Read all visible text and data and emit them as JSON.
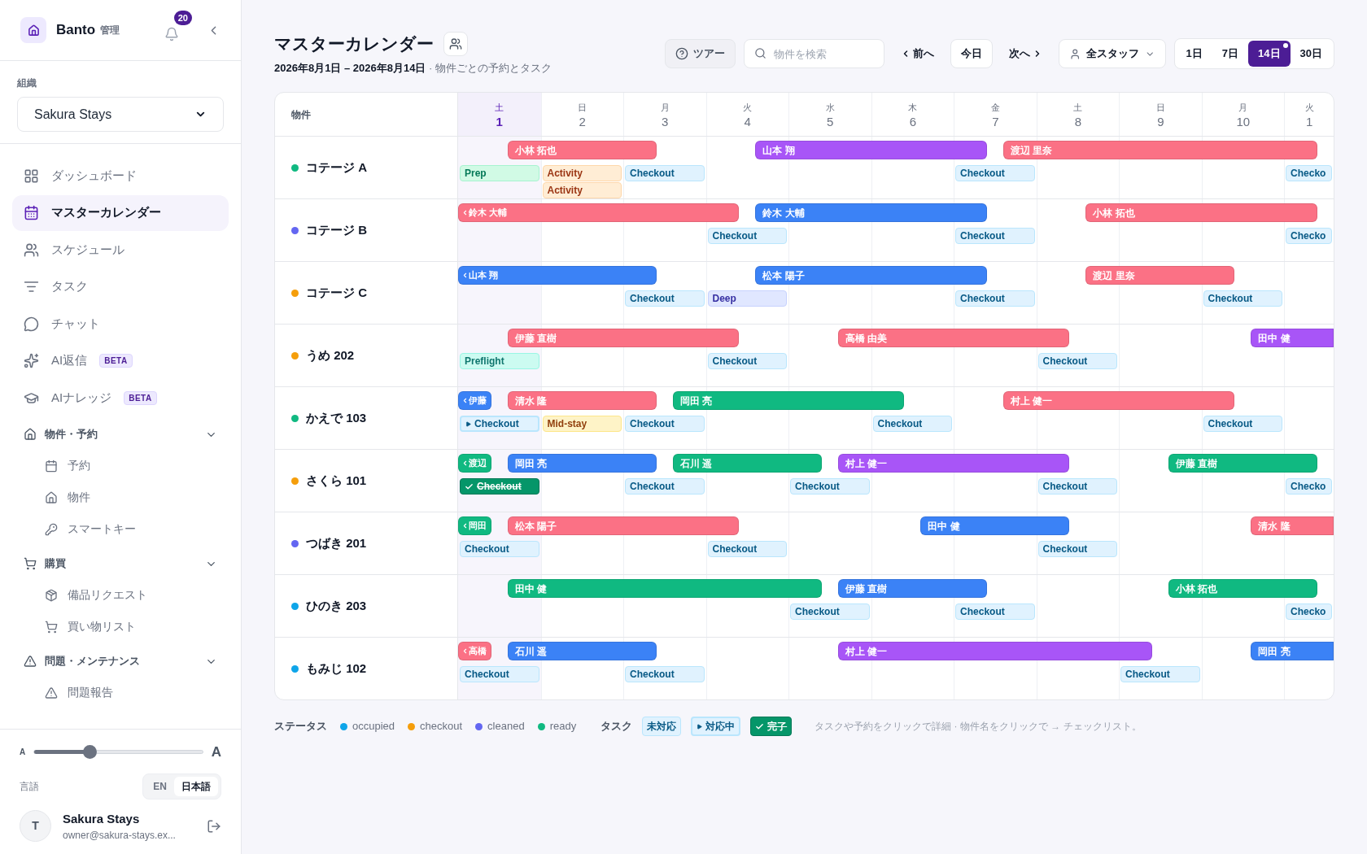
{
  "sidebar": {
    "brand": "Banto",
    "brand_tag": "管理",
    "notifications": "20",
    "org_label": "組織",
    "org_value": "Sakura Stays",
    "nav": [
      {
        "label": "ダッシュボード",
        "selected": false
      },
      {
        "label": "マスターカレンダー",
        "selected": true
      },
      {
        "label": "スケジュール",
        "selected": false
      },
      {
        "label": "タスク",
        "selected": false
      },
      {
        "label": "チャット",
        "selected": false
      },
      {
        "label": "AI返信",
        "selected": false,
        "badge": "BETA"
      },
      {
        "label": "AIナレッジ",
        "selected": false,
        "badge": "BETA"
      }
    ],
    "sections": [
      {
        "title": "物件・予約",
        "expanded": true,
        "items": [
          "予約",
          "物件",
          "スマートキー"
        ]
      },
      {
        "title": "購買",
        "expanded": true,
        "items": [
          "備品リクエスト",
          "買い物リスト"
        ]
      },
      {
        "title": "問題・メンテナンス",
        "expanded": true,
        "items": [
          "問題報告"
        ]
      }
    ],
    "font_small": "A",
    "font_large": "A",
    "font_size": {
      "level": 0.33
    },
    "language_label": "言語",
    "languages": [
      {
        "label": "EN",
        "selected": false
      },
      {
        "label": "日本語",
        "selected": true
      }
    ],
    "user": {
      "initial": "T",
      "name": "Sakura Stays",
      "email": "owner@sakura-stays.ex..."
    }
  },
  "header": {
    "title": "マスターカレンダー",
    "range": "2026年8月1日 – 2026年8月14日",
    "subtitle": " · 物件ごとの予約とタスク",
    "tour": "ツアー",
    "search_placeholder": "物件を検索",
    "prev": "前へ",
    "today": "今日",
    "next": "次へ",
    "staff": "全スタッフ",
    "views": [
      {
        "label": "1日",
        "selected": false
      },
      {
        "label": "7日",
        "selected": false
      },
      {
        "label": "14日",
        "selected": true,
        "dot": true
      },
      {
        "label": "30日",
        "selected": false
      }
    ]
  },
  "calendar": {
    "property_heading": "物件",
    "days": [
      {
        "weekday": "土",
        "day": "1",
        "today": true
      },
      {
        "weekday": "日",
        "day": "2",
        "today": false
      },
      {
        "weekday": "月",
        "day": "3",
        "today": false
      },
      {
        "weekday": "火",
        "day": "4",
        "today": false
      },
      {
        "weekday": "水",
        "day": "5",
        "today": false
      },
      {
        "weekday": "木",
        "day": "6",
        "today": false
      },
      {
        "weekday": "金",
        "day": "7",
        "today": false
      },
      {
        "weekday": "土",
        "day": "8",
        "today": false
      },
      {
        "weekday": "日",
        "day": "9",
        "today": false
      },
      {
        "weekday": "月",
        "day": "10",
        "today": false
      },
      {
        "weekday": "火",
        "day": "1",
        "today": false
      }
    ],
    "properties": [
      {
        "name": "コテージ A",
        "color": "#10b981",
        "bookings": [
          {
            "guest": "小林 拓也",
            "color": "#fb7185",
            "continued": false,
            "continues": false
          },
          {
            "guest": "山本 翔",
            "color": "#a855f7",
            "continued": false,
            "continues": false
          },
          {
            "guest": "渡辺 里奈",
            "color": "#fb7185",
            "continued": false,
            "continues": false
          }
        ],
        "tasks": [
          {
            "label": "Prep",
            "kind": "prep",
            "in_progress": false,
            "done": false
          },
          {
            "label": "Activity",
            "kind": "activity",
            "in_progress": false,
            "done": false
          },
          {
            "label": "Activity",
            "kind": "activity",
            "in_progress": false,
            "done": false
          },
          {
            "label": "Checkout",
            "kind": "checkout",
            "in_progress": false,
            "done": false
          },
          {
            "label": "Checkout",
            "kind": "checkout",
            "in_progress": false,
            "done": false
          },
          {
            "label": "Checko",
            "kind": "checkout",
            "in_progress": false,
            "done": false
          }
        ]
      },
      {
        "name": "コテージ B",
        "color": "#6366f1",
        "bookings": [
          {
            "guest": "鈴木 大輔",
            "color": "#fb7185",
            "continued": true,
            "continues": false
          },
          {
            "guest": "鈴木 大輔",
            "color": "#3b82f6",
            "continued": false,
            "continues": false
          },
          {
            "guest": "小林 拓也",
            "color": "#fb7185",
            "continued": false,
            "continues": false
          }
        ],
        "tasks": [
          {
            "label": "Checkout",
            "kind": "checkout",
            "in_progress": false,
            "done": false
          },
          {
            "label": "Checkout",
            "kind": "checkout",
            "in_progress": false,
            "done": false
          },
          {
            "label": "Checko",
            "kind": "checkout",
            "in_progress": false,
            "done": false
          }
        ]
      },
      {
        "name": "コテージ C",
        "color": "#f59e0b",
        "bookings": [
          {
            "guest": "山本 翔",
            "color": "#3b82f6",
            "continued": true,
            "continues": false
          },
          {
            "guest": "松本 陽子",
            "color": "#3b82f6",
            "continued": false,
            "continues": false
          },
          {
            "guest": "渡辺 里奈",
            "color": "#fb7185",
            "continued": false,
            "continues": false
          }
        ],
        "tasks": [
          {
            "label": "Checkout",
            "kind": "checkout",
            "in_progress": false,
            "done": false
          },
          {
            "label": "Deep",
            "kind": "deep",
            "in_progress": false,
            "done": false
          },
          {
            "label": "Checkout",
            "kind": "checkout",
            "in_progress": false,
            "done": false
          },
          {
            "label": "Checkout",
            "kind": "checkout",
            "in_progress": false,
            "done": false
          }
        ]
      },
      {
        "name": "うめ 202",
        "color": "#f59e0b",
        "bookings": [
          {
            "guest": "伊藤 直樹",
            "color": "#fb7185",
            "continued": false,
            "continues": false
          },
          {
            "guest": "高橋 由美",
            "color": "#fb7185",
            "continued": false,
            "continues": false
          },
          {
            "guest": "田中 健",
            "color": "#a855f7",
            "continued": false,
            "continues": true
          }
        ],
        "tasks": [
          {
            "label": "Preflight",
            "kind": "preflight",
            "in_progress": false,
            "done": false
          },
          {
            "label": "Checkout",
            "kind": "checkout",
            "in_progress": false,
            "done": false
          },
          {
            "label": "Checkout",
            "kind": "checkout",
            "in_progress": false,
            "done": false
          }
        ]
      },
      {
        "name": "かえで 103",
        "color": "#10b981",
        "bookings": [
          {
            "guest": "伊藤",
            "color": "#3b82f6",
            "continued": true,
            "continues": false
          },
          {
            "guest": "清水 隆",
            "color": "#fb7185",
            "continued": false,
            "continues": false
          },
          {
            "guest": "岡田 亮",
            "color": "#10b981",
            "continued": false,
            "continues": false
          },
          {
            "guest": "村上 健一",
            "color": "#fb7185",
            "continued": false,
            "continues": false
          }
        ],
        "tasks": [
          {
            "label": "Checkout",
            "kind": "checkout",
            "in_progress": true,
            "done": false
          },
          {
            "label": "Mid-stay",
            "kind": "midstay",
            "in_progress": false,
            "done": false
          },
          {
            "label": "Checkout",
            "kind": "checkout",
            "in_progress": false,
            "done": false
          },
          {
            "label": "Checkout",
            "kind": "checkout",
            "in_progress": false,
            "done": false
          },
          {
            "label": "Checkout",
            "kind": "checkout",
            "in_progress": false,
            "done": false
          }
        ]
      },
      {
        "name": "さくら 101",
        "color": "#f59e0b",
        "bookings": [
          {
            "guest": "渡辺",
            "color": "#10b981",
            "continued": true,
            "continues": false
          },
          {
            "guest": "岡田 亮",
            "color": "#3b82f6",
            "continued": false,
            "continues": false
          },
          {
            "guest": "石川 遥",
            "color": "#10b981",
            "continued": false,
            "continues": false
          },
          {
            "guest": "村上 健一",
            "color": "#a855f7",
            "continued": false,
            "continues": false
          },
          {
            "guest": "伊藤 直樹",
            "color": "#10b981",
            "continued": false,
            "continues": false
          }
        ],
        "tasks": [
          {
            "label": "Checkout",
            "kind": "checkout",
            "in_progress": false,
            "done": true
          },
          {
            "label": "Checkout",
            "kind": "checkout",
            "in_progress": false,
            "done": false
          },
          {
            "label": "Checkout",
            "kind": "checkout",
            "in_progress": false,
            "done": false
          },
          {
            "label": "Checkout",
            "kind": "checkout",
            "in_progress": false,
            "done": false
          },
          {
            "label": "Checko",
            "kind": "checkout",
            "in_progress": false,
            "done": false
          }
        ]
      },
      {
        "name": "つばき 201",
        "color": "#6366f1",
        "bookings": [
          {
            "guest": "岡田",
            "color": "#10b981",
            "continued": true,
            "continues": false
          },
          {
            "guest": "松本 陽子",
            "color": "#fb7185",
            "continued": false,
            "continues": false
          },
          {
            "guest": "田中 健",
            "color": "#3b82f6",
            "continued": false,
            "continues": false
          },
          {
            "guest": "清水 隆",
            "color": "#fb7185",
            "continued": false,
            "continues": true
          }
        ],
        "tasks": [
          {
            "label": "Checkout",
            "kind": "checkout",
            "in_progress": false,
            "done": false
          },
          {
            "label": "Checkout",
            "kind": "checkout",
            "in_progress": false,
            "done": false
          },
          {
            "label": "Checkout",
            "kind": "checkout",
            "in_progress": false,
            "done": false
          }
        ]
      },
      {
        "name": "ひのき 203",
        "color": "#0ea5e9",
        "bookings": [
          {
            "guest": "田中 健",
            "color": "#10b981",
            "continued": false,
            "continues": false
          },
          {
            "guest": "伊藤 直樹",
            "color": "#3b82f6",
            "continued": false,
            "continues": false
          },
          {
            "guest": "小林 拓也",
            "color": "#10b981",
            "continued": false,
            "continues": false
          }
        ],
        "tasks": [
          {
            "label": "Checkout",
            "kind": "checkout",
            "in_progress": false,
            "done": false
          },
          {
            "label": "Checkout",
            "kind": "checkout",
            "in_progress": false,
            "done": false
          },
          {
            "label": "Checko",
            "kind": "checkout",
            "in_progress": false,
            "done": false
          }
        ]
      },
      {
        "name": "もみじ 102",
        "color": "#0ea5e9",
        "bookings": [
          {
            "guest": "高橋",
            "color": "#fb7185",
            "continued": true,
            "continues": false
          },
          {
            "guest": "石川 遥",
            "color": "#3b82f6",
            "continued": false,
            "continues": false
          },
          {
            "guest": "村上 健一",
            "color": "#a855f7",
            "continued": false,
            "continues": false
          },
          {
            "guest": "岡田 亮",
            "color": "#3b82f6",
            "continued": false,
            "continues": true
          }
        ],
        "tasks": [
          {
            "label": "Checkout",
            "kind": "checkout",
            "in_progress": false,
            "done": false
          },
          {
            "label": "Checkout",
            "kind": "checkout",
            "in_progress": false,
            "done": false
          },
          {
            "label": "Checkout",
            "kind": "checkout",
            "in_progress": false,
            "done": false
          }
        ]
      }
    ]
  },
  "legend": {
    "status_label": "ステータス",
    "statuses": [
      {
        "label": "occupied",
        "color": "#0ea5e9"
      },
      {
        "label": "checkout",
        "color": "#f59e0b"
      },
      {
        "label": "cleaned",
        "color": "#6366f1"
      },
      {
        "label": "ready",
        "color": "#10b981"
      }
    ],
    "task_label": "タスク",
    "task_states": [
      {
        "label": "未対応",
        "in_progress": false,
        "done": false
      },
      {
        "label": "対応中",
        "in_progress": true,
        "done": false
      },
      {
        "label": "完了",
        "in_progress": false,
        "done": true
      }
    ],
    "hint": "タスクや予約をクリックで詳細 · 物件名をクリックで → チェックリスト。"
  }
}
